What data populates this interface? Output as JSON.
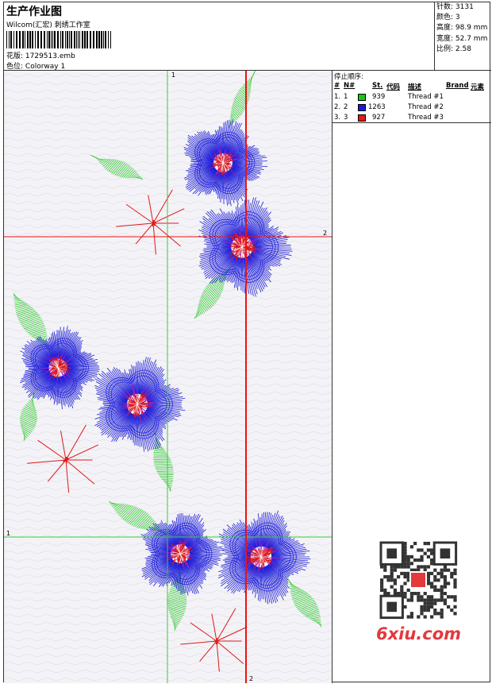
{
  "header": {
    "title": "生产作业图",
    "company": "Wilcom(汇宏) 刺绣工作室",
    "design_label": "花版: ",
    "design_value": "1729513.emb",
    "colorway_label": "色位: ",
    "colorway_value": "Colorway 1"
  },
  "stats": [
    {
      "label": "针数: ",
      "value": "3131"
    },
    {
      "label": "颜色: ",
      "value": "3"
    },
    {
      "label": "高度: ",
      "value": "98.9 mm"
    },
    {
      "label": "宽度: ",
      "value": "52.7 mm"
    },
    {
      "label": "比例: ",
      "value": "2.58"
    }
  ],
  "stop_sequence": {
    "title": "停止顺序:",
    "headers": {
      "hash": "#",
      "n": "N#",
      "st": "St.",
      "code": "代码",
      "desc": "描述",
      "brand": "Brand",
      "element": "元素"
    },
    "rows": [
      {
        "idx": "1.",
        "n": "1",
        "color": "#19c419",
        "stitches": "939",
        "desc": "Thread #1"
      },
      {
        "idx": "2.",
        "n": "2",
        "color": "#1a1ad8",
        "stitches": "1263",
        "desc": "Thread #2"
      },
      {
        "idx": "3.",
        "n": "3",
        "color": "#e01818",
        "stitches": "927",
        "desc": "Thread #3"
      }
    ]
  },
  "guides": {
    "green_top": "1",
    "green_left": "1",
    "red_right": "2",
    "red_bottom": "2"
  },
  "thread_colors": {
    "green": "#19c419",
    "blue": "#1a1ad8",
    "red": "#e01818",
    "green_guide": "#3ccc3c",
    "red_guide": "#ee1111"
  },
  "watermark": {
    "text": "6xiu.com",
    "icon": "qr-code-icon"
  }
}
